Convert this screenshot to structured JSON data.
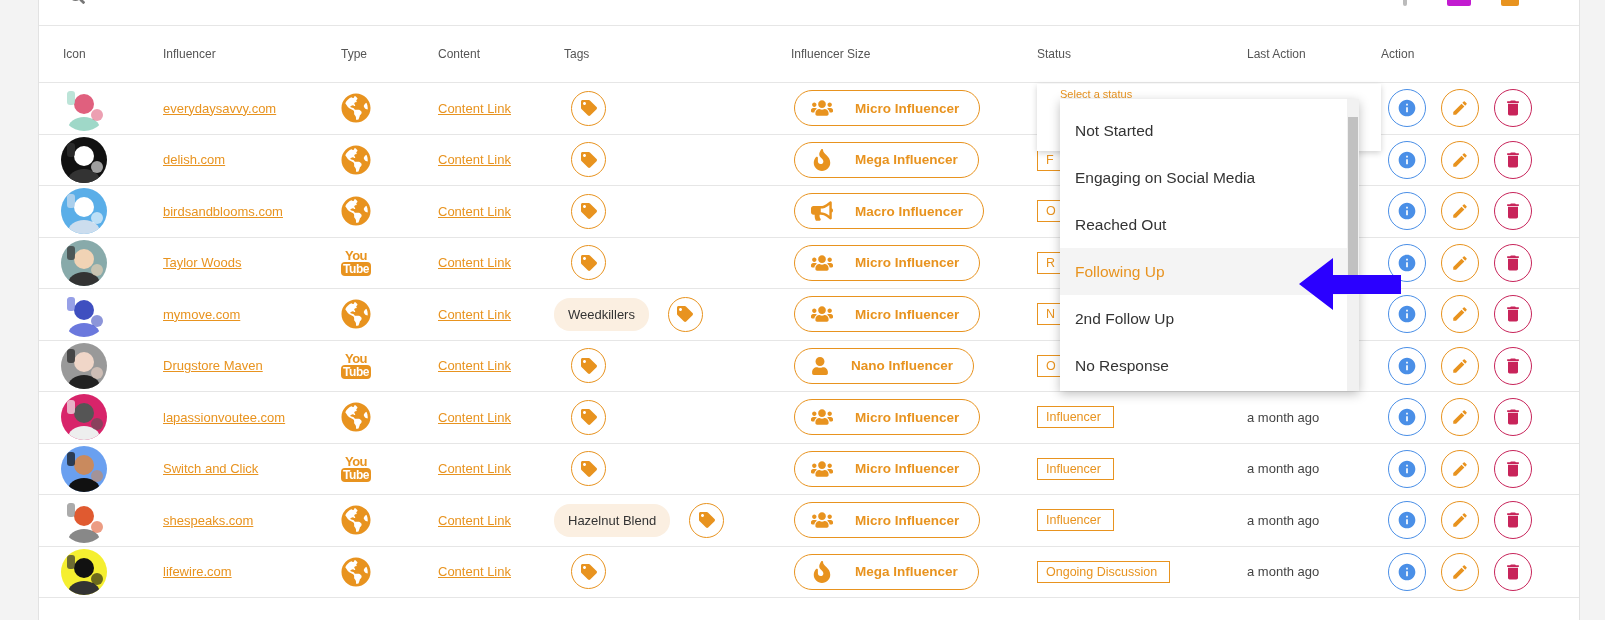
{
  "table": {
    "columns": [
      "Icon",
      "Influencer",
      "Type",
      "Content",
      "Tags",
      "Influencer Size",
      "Status",
      "Last Action",
      "Action"
    ],
    "rows": [
      {
        "name": "everydaysavvy.com",
        "type": {
          "kind": "web"
        },
        "content": "Content Link",
        "tags": [],
        "size": {
          "kind": "group",
          "label": "Micro Influencer"
        }
      },
      {
        "name": "delish.com",
        "type": {
          "kind": "web"
        },
        "content": "Content Link",
        "tags": [],
        "size": {
          "kind": "flame",
          "label": "Mega Influencer"
        },
        "status": "F"
      },
      {
        "name": "birdsandblooms.com",
        "type": {
          "kind": "web"
        },
        "content": "Content Link",
        "tags": [],
        "size": {
          "kind": "megaphone",
          "label": "Macro Influencer"
        },
        "status": "O"
      },
      {
        "name": "Taylor Woods",
        "type": {
          "kind": "video",
          "logo": [
            "You",
            "Tube"
          ]
        },
        "content": "Content Link",
        "tags": [],
        "size": {
          "kind": "group",
          "label": "Micro Influencer"
        },
        "status": "R"
      },
      {
        "name": "mymove.com",
        "type": {
          "kind": "web"
        },
        "content": "Content Link",
        "tags": [
          "Weedkillers"
        ],
        "size": {
          "kind": "group",
          "label": "Micro Influencer"
        },
        "status": "N"
      },
      {
        "name": "Drugstore Maven",
        "type": {
          "kind": "video",
          "logo": [
            "You",
            "Tube"
          ]
        },
        "content": "Content Link",
        "tags": [],
        "size": {
          "kind": "person",
          "label": "Nano Influencer"
        },
        "status": "O"
      },
      {
        "name": "lapassionvoutee.com",
        "type": {
          "kind": "web"
        },
        "content": "Content Link",
        "tags": [],
        "size": {
          "kind": "group",
          "label": "Micro Influencer"
        },
        "status": "Influencer",
        "last_action": "a month ago"
      },
      {
        "name": "Switch and Click",
        "type": {
          "kind": "video",
          "logo": [
            "You",
            "Tube"
          ]
        },
        "content": "Content Link",
        "tags": [],
        "size": {
          "kind": "group",
          "label": "Micro Influencer"
        },
        "status": "Influencer",
        "last_action": "a month ago"
      },
      {
        "name": "shespeaks.com",
        "type": {
          "kind": "web"
        },
        "content": "Content Link",
        "tags": [
          "Hazelnut Blend"
        ],
        "size": {
          "kind": "group",
          "label": "Micro Influencer"
        },
        "status": "Influencer",
        "last_action": "a month ago"
      },
      {
        "name": "lifewire.com",
        "type": {
          "kind": "web"
        },
        "content": "Content Link",
        "tags": [],
        "size": {
          "kind": "flame",
          "label": "Mega Influencer"
        },
        "status": "Ongoing Discussion",
        "last_action": "a month ago"
      }
    ]
  },
  "status_select": {
    "label": "Select a status",
    "options": [
      {
        "label": "Not Started",
        "selected": false
      },
      {
        "label": "Engaging on Social Media",
        "selected": false
      },
      {
        "label": "Reached Out",
        "selected": false
      },
      {
        "label": "Following Up",
        "selected": true
      },
      {
        "label": "2nd Follow Up",
        "selected": false
      },
      {
        "label": "No Response",
        "selected": false
      }
    ]
  }
}
